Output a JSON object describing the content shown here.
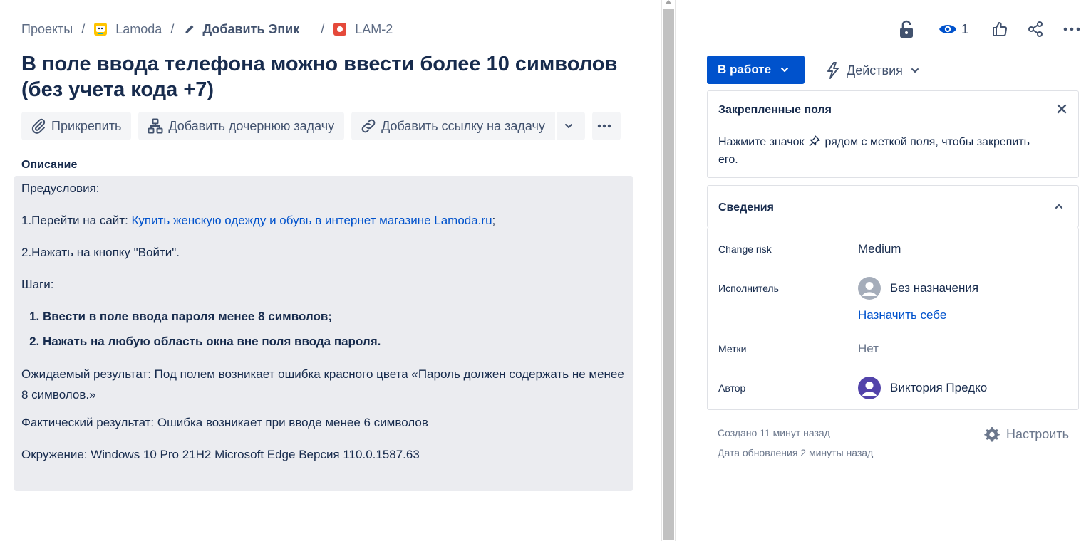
{
  "breadcrumb": {
    "projects": "Проекты",
    "project": "Lamoda",
    "epic": "Добавить Эпик",
    "issue_key": "LAM-2",
    "separator": "/"
  },
  "issue": {
    "title": "В поле ввода телефона можно ввести более 10 символов (без учета кода +7)"
  },
  "toolbar": {
    "attach": "Прикрепить",
    "add_child": "Добавить дочернюю задачу",
    "add_link": "Добавить ссылку на задачу"
  },
  "description": {
    "label": "Описание",
    "preconditions": "Предусловия:",
    "step1_prefix": "1.Перейти на сайт: ",
    "step1_link": "Купить женскую одежду и обувь в интернет магазине Lamoda.ru",
    "step1_suffix": ";",
    "step2": "2.Нажать на кнопку \"Войти\".",
    "steps_label": "Шаги:",
    "steps": [
      "Ввести в поле ввода пароля менее 8 символов;",
      "Нажать на любую область окна вне поля ввода пароля."
    ],
    "expected": "Ожидаемый результат: Под полем возникает ошибка красного цвета «Пароль должен содержать не менее 8 символов.»",
    "actual": "Фактический результат: Ошибка возникает при вводе менее 6 символов",
    "environment": "Окружение: Windows 10 Pro 21H2 Microsoft Edge Версия 110.0.1587.63"
  },
  "top_actions": {
    "watchers_count": "1"
  },
  "status": {
    "label": "В работе",
    "color": "#0052cc"
  },
  "actions": {
    "label": "Действия"
  },
  "pinned": {
    "title": "Закрепленные поля",
    "hint_before": "Нажмите значок",
    "hint_after": "рядом с меткой поля, чтобы закрепить его."
  },
  "details": {
    "title": "Сведения",
    "fields": [
      {
        "label": "Change risk",
        "value": "Medium"
      },
      {
        "label": "Исполнитель",
        "value": "Без назначения"
      },
      {
        "label": "Метки",
        "value": "Нет"
      },
      {
        "label": "Автор",
        "value": "Виктория Предко"
      }
    ],
    "assign_self": "Назначить себе"
  },
  "meta": {
    "created": "Создано 11 минут назад",
    "updated": "Дата обновления 2 минуты назад",
    "configure": "Настроить"
  }
}
